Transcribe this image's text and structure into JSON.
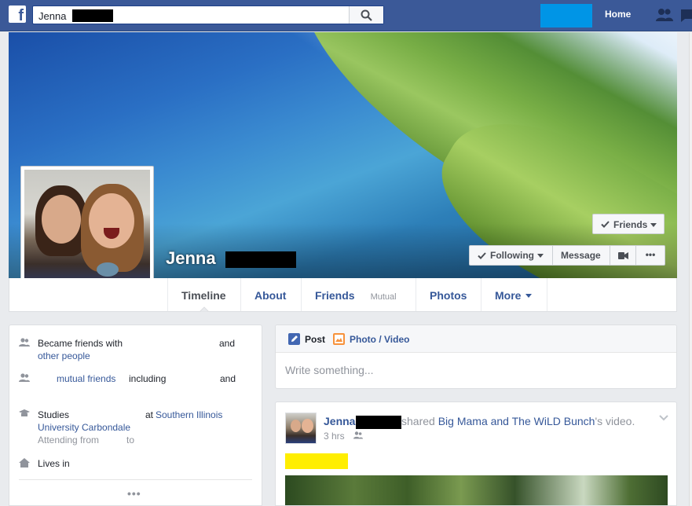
{
  "topbar": {
    "search_value": "Jenna",
    "home_label": "Home",
    "colors": {
      "bar": "#3b5998",
      "accent_block": "#0095e6"
    }
  },
  "profile": {
    "first_name": "Jenna",
    "friends_button": "Friends",
    "following_button": "Following",
    "message_button": "Message",
    "more_button": "•••"
  },
  "nav": {
    "tabs": [
      {
        "label": "Timeline"
      },
      {
        "label": "About"
      },
      {
        "label": "Friends",
        "sub": "Mutual"
      },
      {
        "label": "Photos"
      },
      {
        "label": "More"
      }
    ]
  },
  "intro": {
    "row1_text": "Became friends with",
    "row1_and": "and",
    "row1_link": "other people",
    "row2_link": "mutual friends",
    "row2_text": "including",
    "row2_and": "and",
    "row3_text": "Studies",
    "row3_at": "at",
    "row3_link1": "Southern Illinois",
    "row3_link2": "University Carbondale",
    "row3_from": "Attending from",
    "row3_to": "to",
    "row4_text": "Lives in",
    "more": "•••"
  },
  "composer": {
    "tab_post": "Post",
    "tab_photo": "Photo / Video",
    "placeholder": "Write something..."
  },
  "post": {
    "author": "Jenna",
    "action_prefix": "shared",
    "shared_link": "Big Mama and The WiLD Bunch",
    "action_suffix": "'s video.",
    "time": "3 hrs",
    "audience_icon": "friends-icon"
  }
}
